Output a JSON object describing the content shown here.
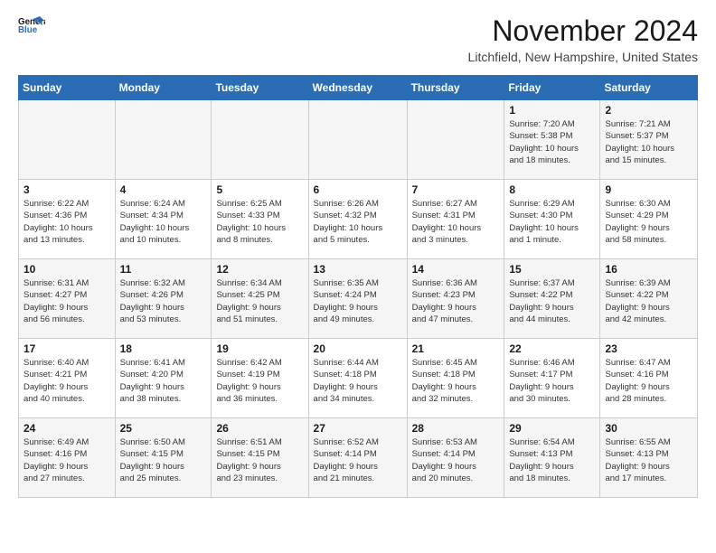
{
  "header": {
    "logo_line1": "General",
    "logo_line2": "Blue",
    "month_title": "November 2024",
    "location": "Litchfield, New Hampshire, United States"
  },
  "calendar": {
    "weekdays": [
      "Sunday",
      "Monday",
      "Tuesday",
      "Wednesday",
      "Thursday",
      "Friday",
      "Saturday"
    ],
    "weeks": [
      [
        {
          "day": "",
          "info": ""
        },
        {
          "day": "",
          "info": ""
        },
        {
          "day": "",
          "info": ""
        },
        {
          "day": "",
          "info": ""
        },
        {
          "day": "",
          "info": ""
        },
        {
          "day": "1",
          "info": "Sunrise: 7:20 AM\nSunset: 5:38 PM\nDaylight: 10 hours\nand 18 minutes."
        },
        {
          "day": "2",
          "info": "Sunrise: 7:21 AM\nSunset: 5:37 PM\nDaylight: 10 hours\nand 15 minutes."
        }
      ],
      [
        {
          "day": "3",
          "info": "Sunrise: 6:22 AM\nSunset: 4:36 PM\nDaylight: 10 hours\nand 13 minutes."
        },
        {
          "day": "4",
          "info": "Sunrise: 6:24 AM\nSunset: 4:34 PM\nDaylight: 10 hours\nand 10 minutes."
        },
        {
          "day": "5",
          "info": "Sunrise: 6:25 AM\nSunset: 4:33 PM\nDaylight: 10 hours\nand 8 minutes."
        },
        {
          "day": "6",
          "info": "Sunrise: 6:26 AM\nSunset: 4:32 PM\nDaylight: 10 hours\nand 5 minutes."
        },
        {
          "day": "7",
          "info": "Sunrise: 6:27 AM\nSunset: 4:31 PM\nDaylight: 10 hours\nand 3 minutes."
        },
        {
          "day": "8",
          "info": "Sunrise: 6:29 AM\nSunset: 4:30 PM\nDaylight: 10 hours\nand 1 minute."
        },
        {
          "day": "9",
          "info": "Sunrise: 6:30 AM\nSunset: 4:29 PM\nDaylight: 9 hours\nand 58 minutes."
        }
      ],
      [
        {
          "day": "10",
          "info": "Sunrise: 6:31 AM\nSunset: 4:27 PM\nDaylight: 9 hours\nand 56 minutes."
        },
        {
          "day": "11",
          "info": "Sunrise: 6:32 AM\nSunset: 4:26 PM\nDaylight: 9 hours\nand 53 minutes."
        },
        {
          "day": "12",
          "info": "Sunrise: 6:34 AM\nSunset: 4:25 PM\nDaylight: 9 hours\nand 51 minutes."
        },
        {
          "day": "13",
          "info": "Sunrise: 6:35 AM\nSunset: 4:24 PM\nDaylight: 9 hours\nand 49 minutes."
        },
        {
          "day": "14",
          "info": "Sunrise: 6:36 AM\nSunset: 4:23 PM\nDaylight: 9 hours\nand 47 minutes."
        },
        {
          "day": "15",
          "info": "Sunrise: 6:37 AM\nSunset: 4:22 PM\nDaylight: 9 hours\nand 44 minutes."
        },
        {
          "day": "16",
          "info": "Sunrise: 6:39 AM\nSunset: 4:22 PM\nDaylight: 9 hours\nand 42 minutes."
        }
      ],
      [
        {
          "day": "17",
          "info": "Sunrise: 6:40 AM\nSunset: 4:21 PM\nDaylight: 9 hours\nand 40 minutes."
        },
        {
          "day": "18",
          "info": "Sunrise: 6:41 AM\nSunset: 4:20 PM\nDaylight: 9 hours\nand 38 minutes."
        },
        {
          "day": "19",
          "info": "Sunrise: 6:42 AM\nSunset: 4:19 PM\nDaylight: 9 hours\nand 36 minutes."
        },
        {
          "day": "20",
          "info": "Sunrise: 6:44 AM\nSunset: 4:18 PM\nDaylight: 9 hours\nand 34 minutes."
        },
        {
          "day": "21",
          "info": "Sunrise: 6:45 AM\nSunset: 4:18 PM\nDaylight: 9 hours\nand 32 minutes."
        },
        {
          "day": "22",
          "info": "Sunrise: 6:46 AM\nSunset: 4:17 PM\nDaylight: 9 hours\nand 30 minutes."
        },
        {
          "day": "23",
          "info": "Sunrise: 6:47 AM\nSunset: 4:16 PM\nDaylight: 9 hours\nand 28 minutes."
        }
      ],
      [
        {
          "day": "24",
          "info": "Sunrise: 6:49 AM\nSunset: 4:16 PM\nDaylight: 9 hours\nand 27 minutes."
        },
        {
          "day": "25",
          "info": "Sunrise: 6:50 AM\nSunset: 4:15 PM\nDaylight: 9 hours\nand 25 minutes."
        },
        {
          "day": "26",
          "info": "Sunrise: 6:51 AM\nSunset: 4:15 PM\nDaylight: 9 hours\nand 23 minutes."
        },
        {
          "day": "27",
          "info": "Sunrise: 6:52 AM\nSunset: 4:14 PM\nDaylight: 9 hours\nand 21 minutes."
        },
        {
          "day": "28",
          "info": "Sunrise: 6:53 AM\nSunset: 4:14 PM\nDaylight: 9 hours\nand 20 minutes."
        },
        {
          "day": "29",
          "info": "Sunrise: 6:54 AM\nSunset: 4:13 PM\nDaylight: 9 hours\nand 18 minutes."
        },
        {
          "day": "30",
          "info": "Sunrise: 6:55 AM\nSunset: 4:13 PM\nDaylight: 9 hours\nand 17 minutes."
        }
      ]
    ]
  }
}
